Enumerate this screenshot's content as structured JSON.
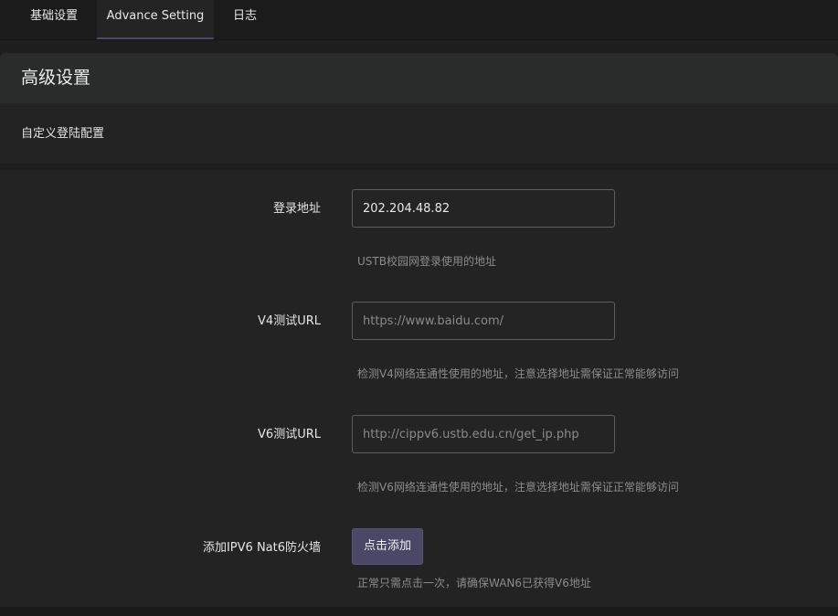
{
  "tabs": [
    {
      "label": "基础设置",
      "active": false
    },
    {
      "label": "Advance Setting",
      "active": true
    },
    {
      "label": "日志",
      "active": false
    }
  ],
  "section": {
    "title": "高级设置",
    "description": "自定义登陆配置"
  },
  "fields": {
    "login_address": {
      "label": "登录地址",
      "value": "202.204.48.82",
      "hint": "USTB校园网登录使用的地址"
    },
    "v4_url": {
      "label": "V4测试URL",
      "placeholder": "https://www.baidu.com/",
      "hint": "检测V4网络连通性使用的地址，注意选择地址需保证正常能够访问"
    },
    "v6_url": {
      "label": "V6测试URL",
      "placeholder": "http://cippv6.ustb.edu.cn/get_ip.php",
      "hint": "检测V6网络连通性使用的地址，注意选择地址需保证正常能够访问"
    },
    "firewall": {
      "label": "添加IPV6 Nat6防火墙",
      "button_label": "点击添加",
      "hint": "正常只需点击一次，请确保WAN6已获得V6地址"
    }
  },
  "colors": {
    "accent": "#4b4766",
    "background": "#1b1b1b",
    "panel": "#232323"
  }
}
